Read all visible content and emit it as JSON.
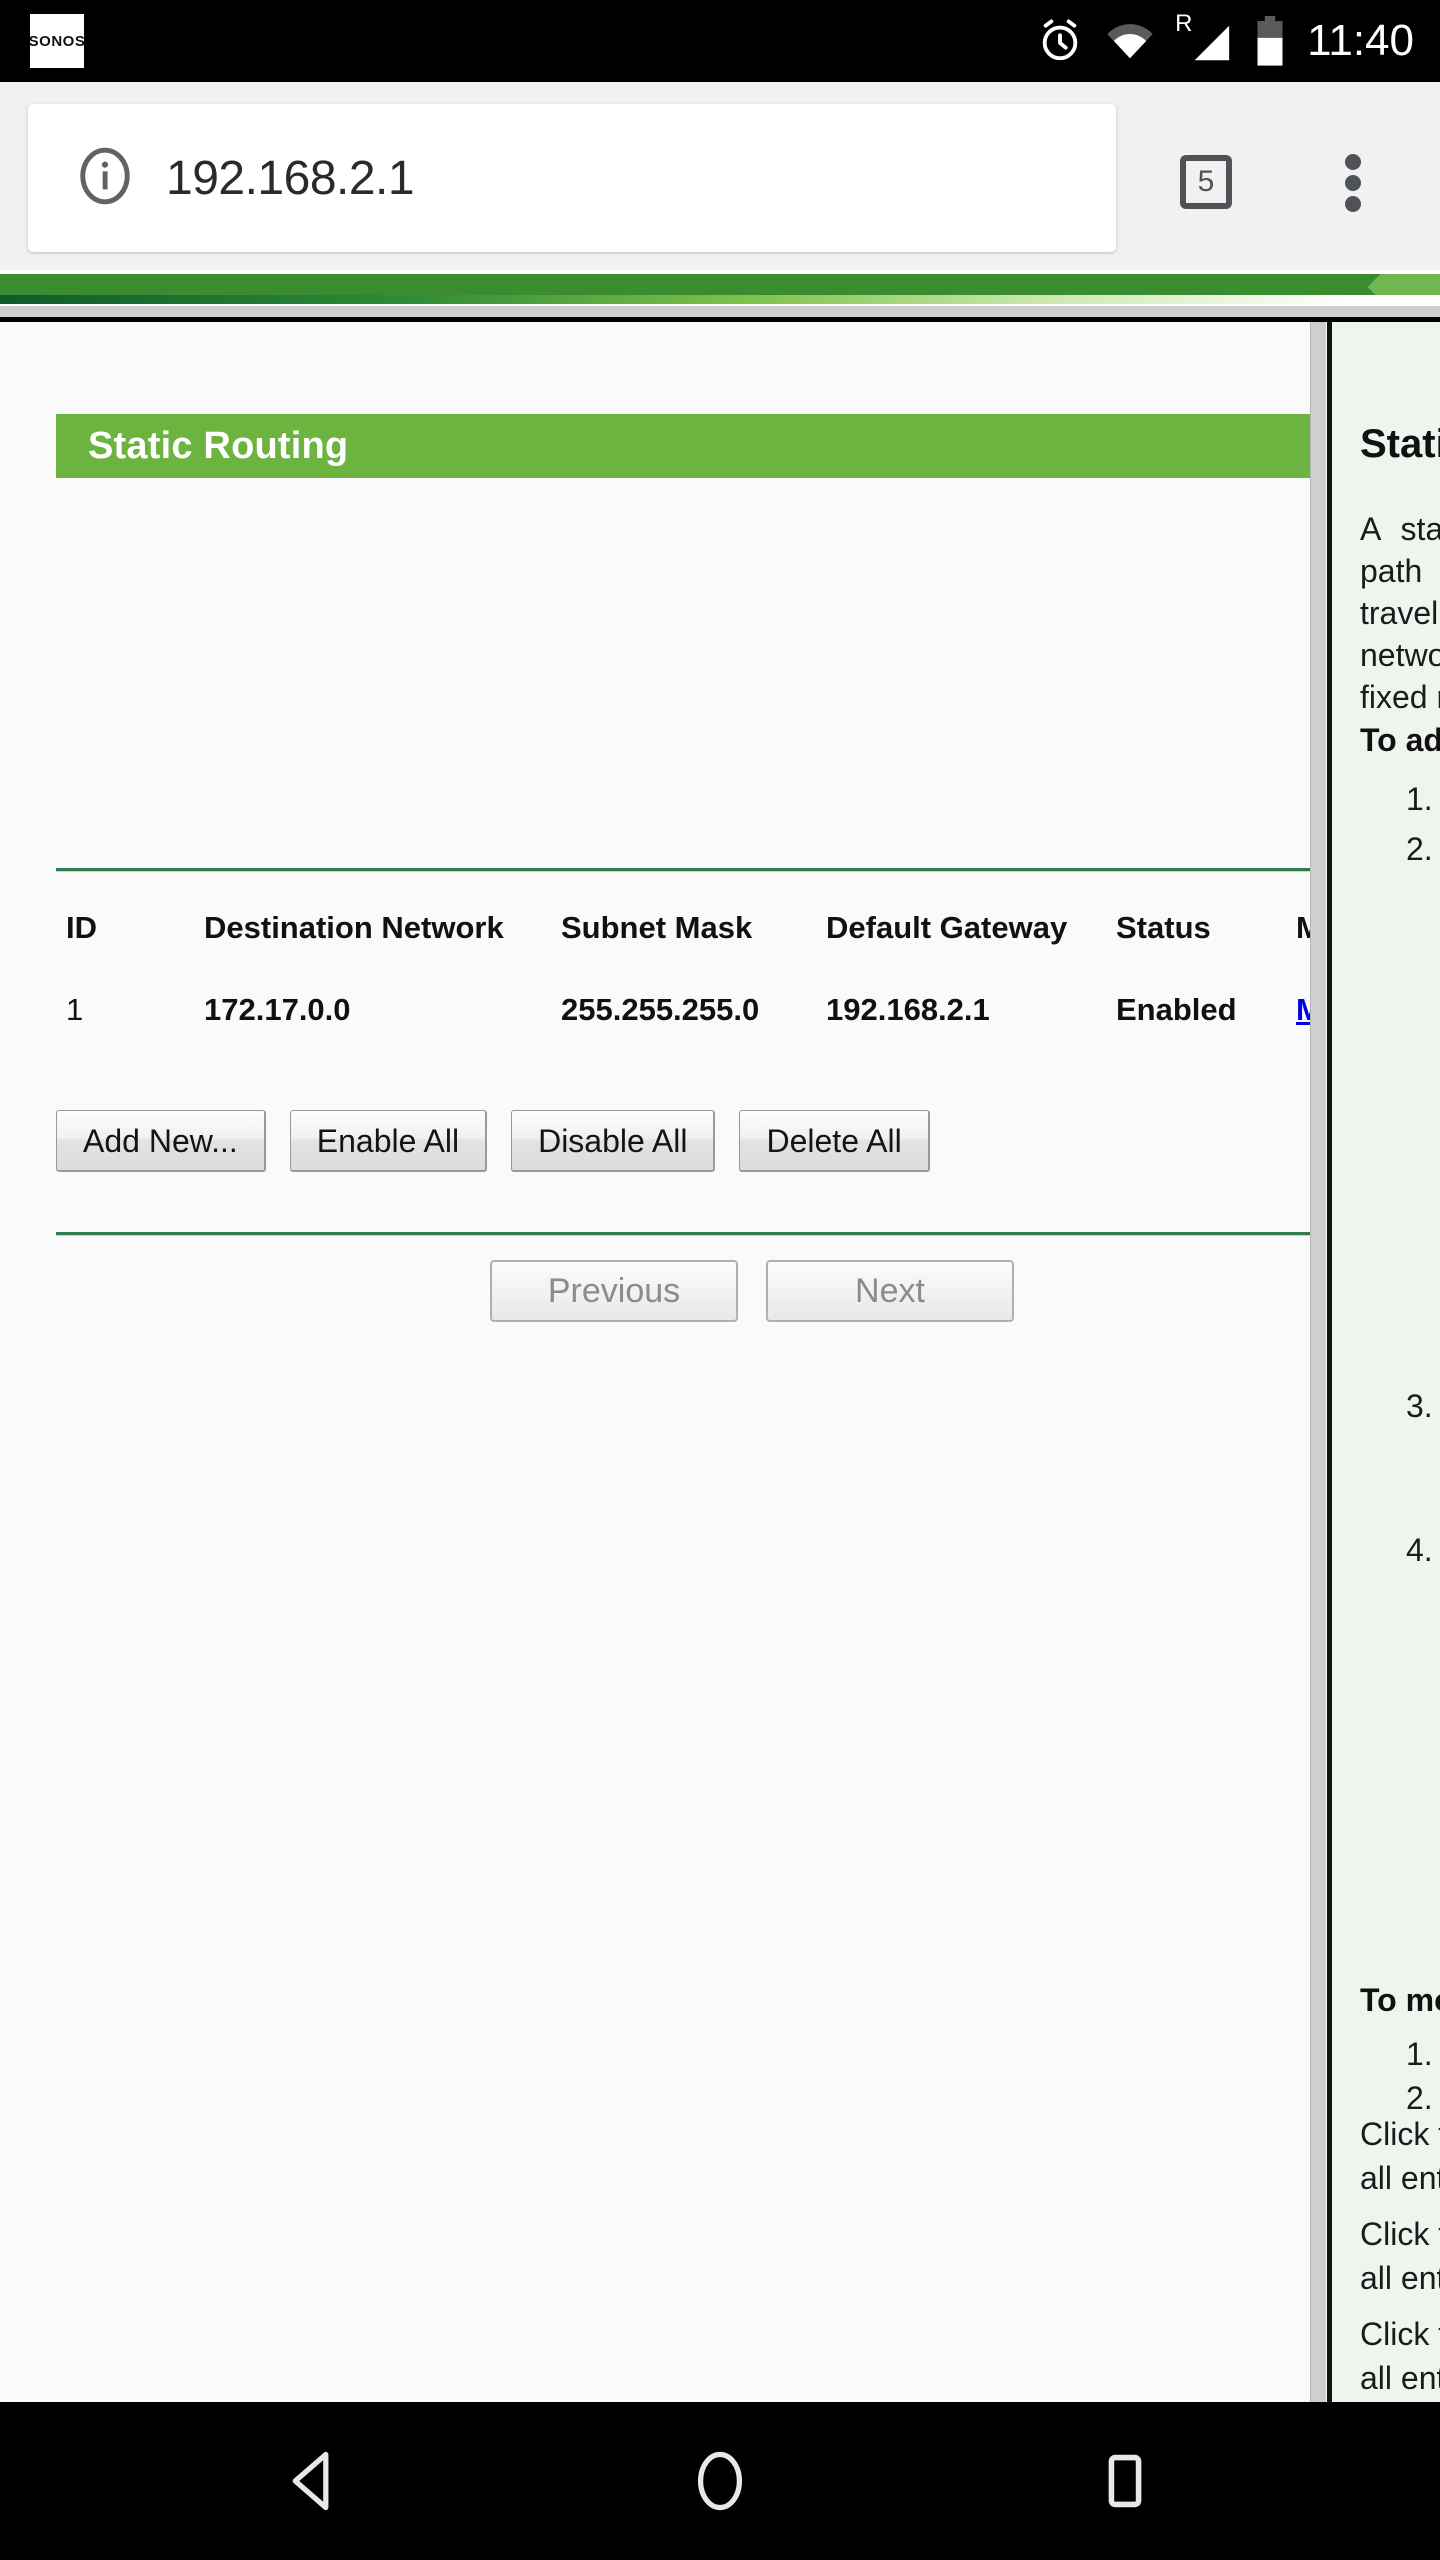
{
  "status_bar": {
    "app_badge_label": "SONOS",
    "icons": [
      "alarm-icon",
      "wifi-icon",
      "roaming-signal-icon",
      "battery-icon"
    ],
    "roaming_letter": "R",
    "clock": "11:40"
  },
  "browser": {
    "url": "192.168.2.1",
    "security_icon": "info-icon",
    "tab_count": "5",
    "menu_icon": "overflow-menu-icon"
  },
  "page": {
    "section_title": "Static Routing",
    "table": {
      "headers": [
        "ID",
        "Destination Network",
        "Subnet Mask",
        "Default Gateway",
        "Status",
        "M"
      ],
      "rows": [
        {
          "id": "1",
          "destination_network": "172.17.0.0",
          "subnet_mask": "255.255.255.0",
          "default_gateway": "192.168.2.1",
          "status": "Enabled",
          "modify_link": "M"
        }
      ]
    },
    "actions": {
      "add_new": "Add New...",
      "enable_all": "Enable All",
      "disable_all": "Disable All",
      "delete_all": "Delete All"
    },
    "pagination": {
      "previous": "Previous",
      "next": "Next"
    }
  },
  "help": {
    "title": "Static Routing",
    "paragraph": "A static route is a pre-determined path that network information must travel to reach a specific host or network. Static routing creates a fixed route.",
    "add_heading": "To add static routing entries:",
    "add_steps": [
      "1.",
      "2."
    ],
    "add_steps_more": [
      "3.",
      "4."
    ],
    "modify_heading": "To modify or delete an existing entry:",
    "modify_steps": [
      "1.",
      "2."
    ],
    "click_notes": [
      "Click the Enable All button to enable all entries.",
      "Click the Disable All button to disable all entries.",
      "Click the Delete All button to delete all entries."
    ]
  },
  "nav_bar": {
    "back": "back-icon",
    "home": "home-icon",
    "recent": "recent-apps-icon"
  },
  "colors": {
    "brand_green": "#6cb33f",
    "banner_green": "#3b8b30",
    "rule_green": "#2f7d4f",
    "help_bg": "#eef5ee",
    "link_blue": "#0000ee"
  }
}
